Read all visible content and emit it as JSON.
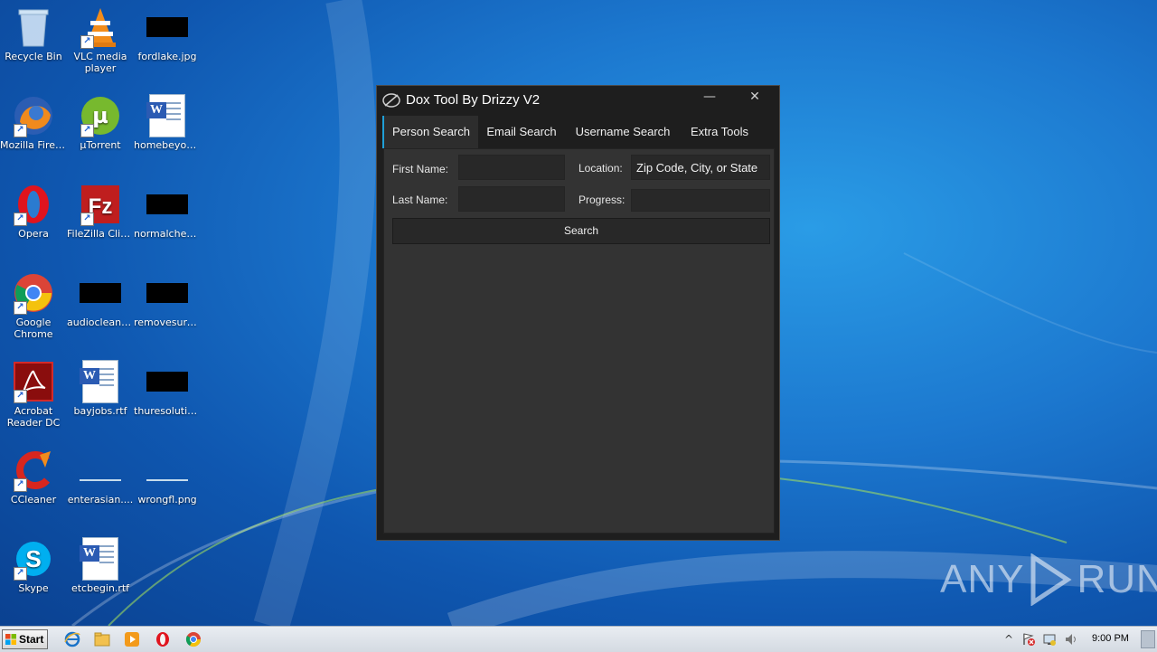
{
  "desktop": {
    "icons": [
      {
        "label": "Recycle Bin"
      },
      {
        "label": "VLC media player"
      },
      {
        "label": "fordlake.jpg"
      },
      {
        "label": "Mozilla Firefox"
      },
      {
        "label": "µTorrent"
      },
      {
        "label": "homebeyon..."
      },
      {
        "label": "Opera"
      },
      {
        "label": "FileZilla Client"
      },
      {
        "label": "normalchec..."
      },
      {
        "label": "Google Chrome"
      },
      {
        "label": "audioclean.jpg"
      },
      {
        "label": "removesure..."
      },
      {
        "label": "Acrobat Reader DC"
      },
      {
        "label": "bayjobs.rtf"
      },
      {
        "label": "thuresolutio..."
      },
      {
        "label": "CCleaner"
      },
      {
        "label": "enterasian...."
      },
      {
        "label": "wrongfl.png"
      },
      {
        "label": "Skype"
      },
      {
        "label": "etcbegin.rtf"
      }
    ]
  },
  "app": {
    "title": "Dox Tool By Drizzy V2",
    "minimize_glyph": "—",
    "close_glyph": "✕",
    "tabs": [
      {
        "label": "Person Search"
      },
      {
        "label": "Email Search"
      },
      {
        "label": "Username Search"
      },
      {
        "label": "Extra Tools"
      }
    ],
    "form": {
      "first_name_label": "First Name:",
      "first_name_value": "",
      "last_name_label": "Last Name:",
      "last_name_value": "",
      "location_label": "Location:",
      "location_placeholder": "Zip Code, City, or State",
      "progress_label": "Progress:",
      "progress_value": "",
      "search_button_label": "Search"
    }
  },
  "watermark": {
    "left": "ANY",
    "right": "RUN"
  },
  "taskbar": {
    "start_label": "Start",
    "pinned": [
      {
        "icon": "internet-explorer-icon"
      },
      {
        "icon": "file-explorer-icon"
      },
      {
        "icon": "media-player-icon"
      },
      {
        "icon": "opera-icon"
      },
      {
        "icon": "chrome-icon"
      }
    ],
    "tray": {
      "clock": "9:00 PM",
      "chevron_glyph": "^"
    }
  },
  "colors": {
    "app_bg": "#1e1e1e",
    "panel_bg": "#333333",
    "input_bg": "#282828",
    "tab_accent": "#1fa0d8"
  }
}
